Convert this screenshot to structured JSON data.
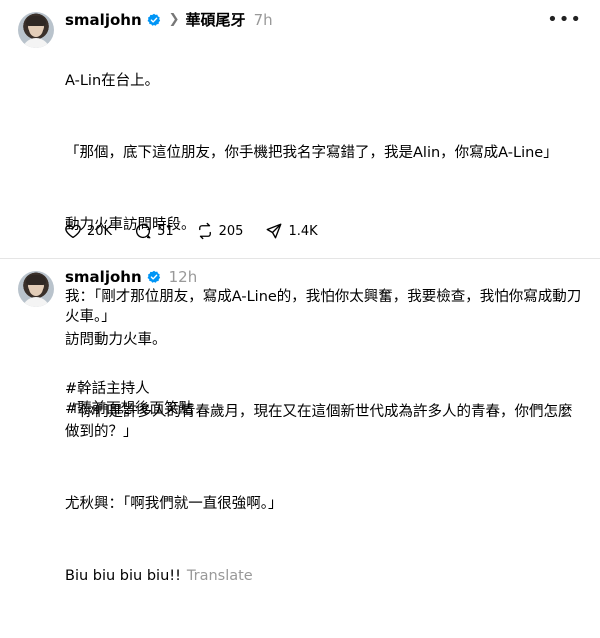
{
  "post1": {
    "username": "smaljohn",
    "parent_name": "華碩尾牙",
    "time": "7h",
    "more_label": "•••",
    "paragraphs": [
      "A-Lin在台上。",
      "「那個，底下這位朋友，你手機把我名字寫錯了，我是Alin，你寫成A-Line」",
      "動力火車訪問時段。",
      "我：「剛才那位朋友，寫成A-Line的，我怕你太興奮，我要檢查，我怕你寫成動刀火車。」",
      "#幹話主持人\n#聽前面想後面笑點"
    ],
    "likes": "20K",
    "replies": "51",
    "reposts": "205",
    "shares": "1.4K"
  },
  "post2": {
    "username": "smaljohn",
    "time": "12h",
    "paragraphs": [
      "訪問動力火車。",
      "「你們是許多人的青春歲月，現在又在這個新世代成為許多人的青春，你們怎麼做到的？」",
      "尤秋興：「啊我們就一直很強啊。」"
    ],
    "last_line": "Biu biu biu biu!!",
    "translate_label": "Translate"
  },
  "colors": {
    "verified": "#0095f6",
    "secondary_text": "#999999",
    "divider": "#e5e5e5"
  },
  "icons": [
    "heart-icon",
    "comment-icon",
    "repost-icon",
    "share-icon",
    "verified-icon",
    "chevron-right-icon",
    "more-icon"
  ]
}
